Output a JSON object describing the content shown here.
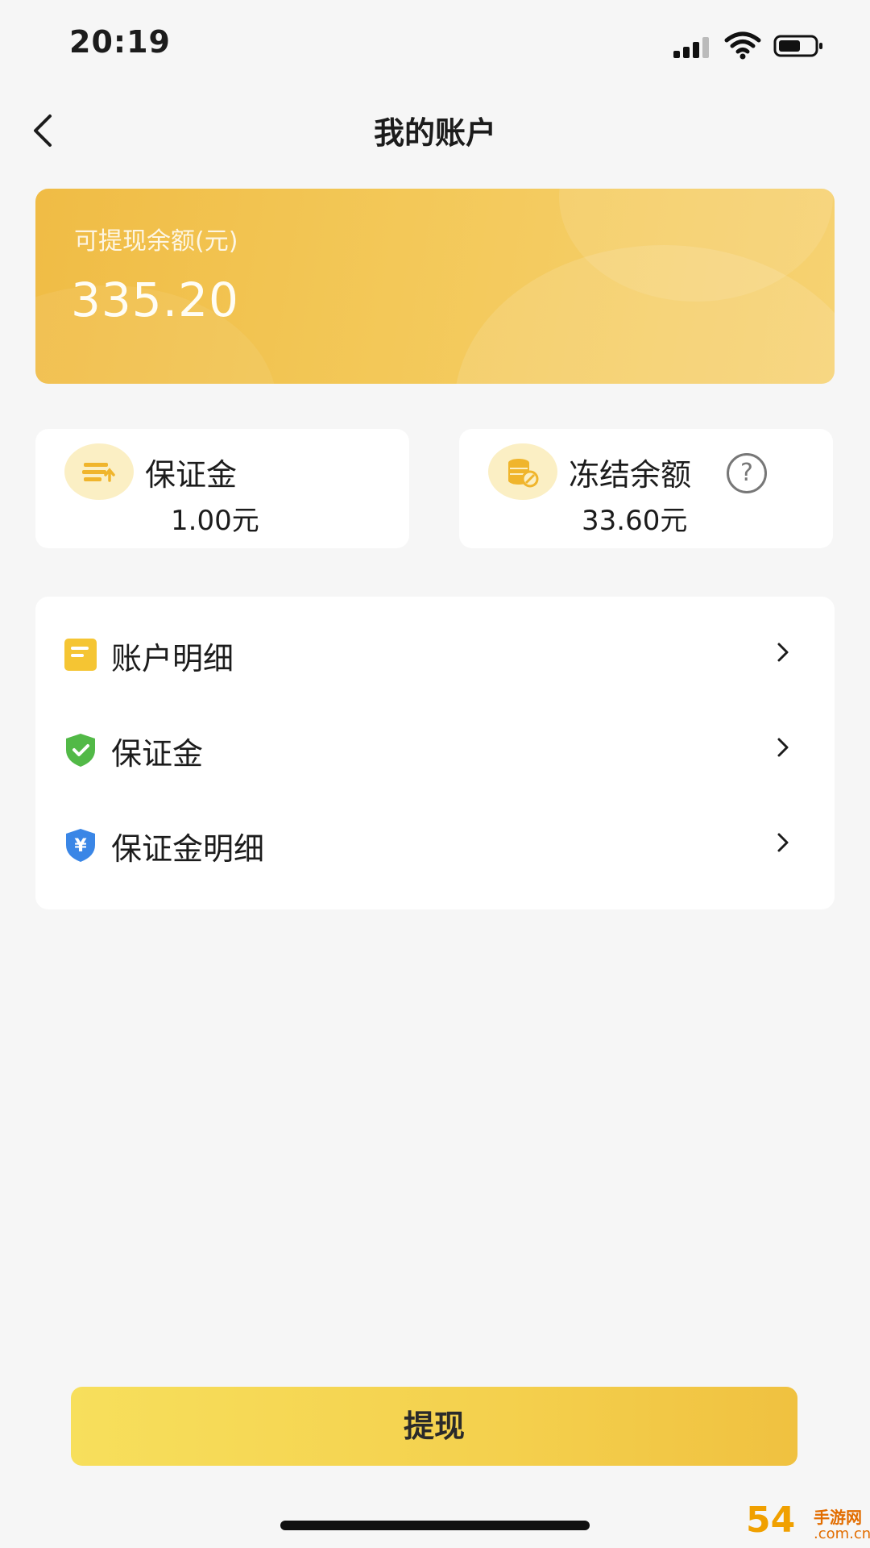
{
  "status_bar": {
    "time": "20:19"
  },
  "nav": {
    "title": "我的账户"
  },
  "balance_card": {
    "label": "可提现余额(元)",
    "value": "335.20"
  },
  "stats": [
    {
      "title": "保证金",
      "value": "1.00元",
      "icon": "deposit-icon"
    },
    {
      "title": "冻结余额",
      "value": "33.60元",
      "icon": "frozen-coins-icon",
      "help_icon": "question-mark-icon",
      "help_symbol": "?"
    }
  ],
  "menu": [
    {
      "label": "账户明细",
      "icon": "document-icon",
      "icon_color": "#f5c533"
    },
    {
      "label": "保证金",
      "icon": "shield-check-icon",
      "icon_color": "#52b947"
    },
    {
      "label": "保证金明细",
      "icon": "shield-yuan-icon",
      "icon_color": "#3a86e6"
    }
  ],
  "withdraw_button": {
    "label": "提现"
  },
  "watermark": {
    "number": "54",
    "text": "手游网",
    "domain": ".com.cn"
  },
  "colors": {
    "accent": "#f4c84f",
    "background": "#f6f6f6",
    "card": "#ffffff"
  }
}
